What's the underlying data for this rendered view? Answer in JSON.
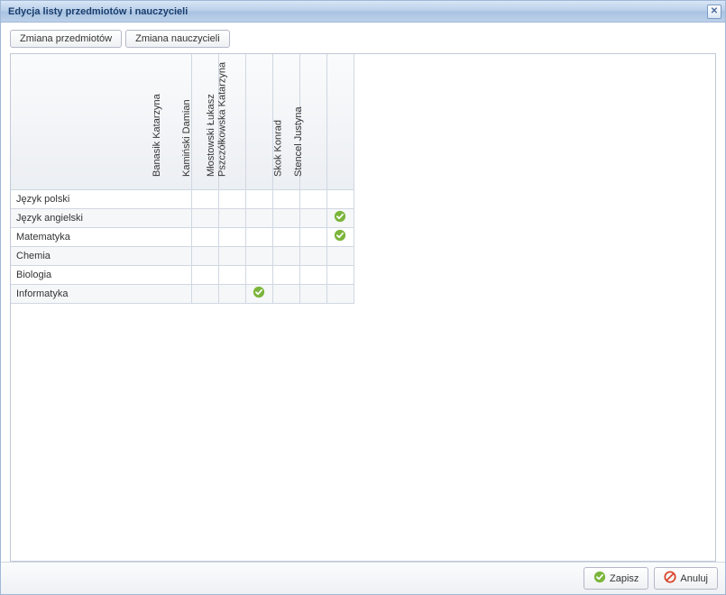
{
  "window": {
    "title": "Edycja listy przedmiotów i nauczycieli"
  },
  "toolbar": {
    "change_subjects": "Zmiana przedmiotów",
    "change_teachers": "Zmiana nauczycieli"
  },
  "teachers": [
    "Banasik Katarzyna",
    "Kamiński Damian",
    "Młostowski Łukasz",
    "Pszczółkowska Katarzyna",
    "Skok Konrad",
    "Stencel Justyna"
  ],
  "subjects": [
    {
      "name": "Język polski",
      "checks": [
        false,
        false,
        false,
        false,
        false,
        false
      ]
    },
    {
      "name": "Język angielski",
      "checks": [
        false,
        false,
        false,
        false,
        false,
        true
      ]
    },
    {
      "name": "Matematyka",
      "checks": [
        false,
        false,
        false,
        false,
        false,
        true
      ]
    },
    {
      "name": "Chemia",
      "checks": [
        false,
        false,
        false,
        false,
        false,
        false
      ]
    },
    {
      "name": "Biologia",
      "checks": [
        false,
        false,
        false,
        false,
        false,
        false
      ]
    },
    {
      "name": "Informatyka",
      "checks": [
        false,
        false,
        true,
        false,
        false,
        false
      ]
    }
  ],
  "footer": {
    "save": "Zapisz",
    "cancel": "Anuluj"
  }
}
